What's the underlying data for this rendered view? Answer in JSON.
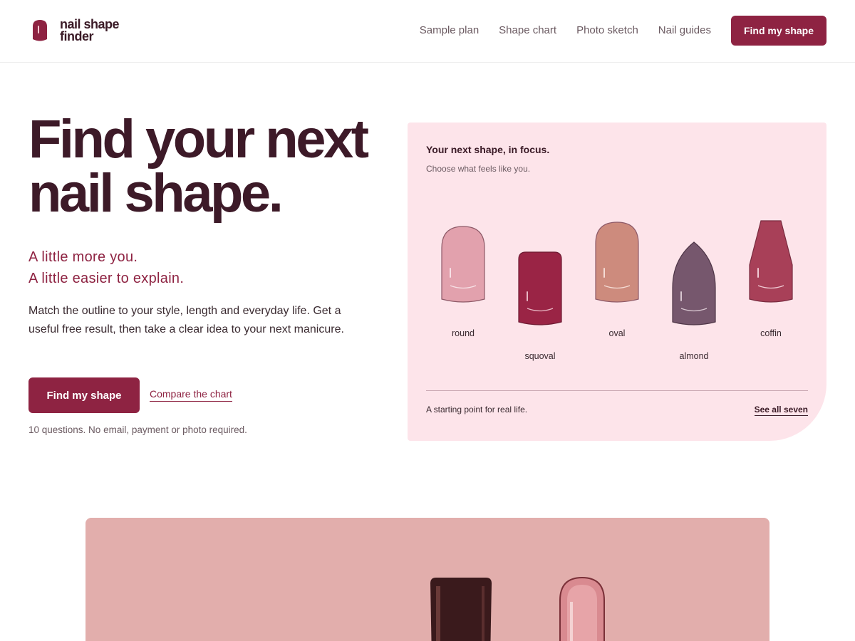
{
  "brand": {
    "name_line1": "nail shape",
    "name_line2": "finder",
    "color": "#8e2342"
  },
  "nav": {
    "items": [
      {
        "label": "Sample plan"
      },
      {
        "label": "Shape chart"
      },
      {
        "label": "Photo sketch"
      },
      {
        "label": "Nail guides"
      }
    ],
    "cta_label": "Find my shape"
  },
  "hero": {
    "title_line1": "Find your next",
    "title_line2": "nail shape.",
    "tagline_line1": "A little more you.",
    "tagline_line2": "A little easier to explain.",
    "description": "Match the outline to your style, length and everyday life. Get a useful free result, then take a clear idea to your next manicure.",
    "primary_button": "Find my shape",
    "secondary_link": "Compare the chart",
    "note": "10 questions. No email, payment or photo required."
  },
  "shape_card": {
    "title": "Your next shape, in focus.",
    "subtitle": "Choose what feels like you.",
    "shapes": [
      {
        "label": "round",
        "color": "#e2a1ad",
        "icon": "round-nail-icon"
      },
      {
        "label": "squoval",
        "color": "#9a2445",
        "icon": "squoval-nail-icon"
      },
      {
        "label": "oval",
        "color": "#cd8b7d",
        "icon": "oval-nail-icon"
      },
      {
        "label": "almond",
        "color": "#76576d",
        "icon": "almond-nail-icon"
      },
      {
        "label": "coffin",
        "color": "#a84058",
        "icon": "coffin-nail-icon"
      }
    ],
    "footer_text": "A starting point for real life.",
    "footer_link": "See all seven"
  },
  "colors": {
    "accent": "#8e2342",
    "heading": "#3d1a28",
    "card_bg": "#fde4ea",
    "photo_bg": "#e2aeac"
  }
}
